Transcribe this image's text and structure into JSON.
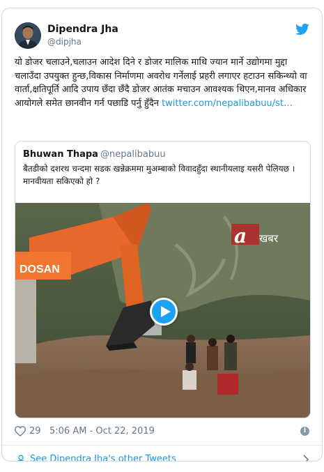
{
  "tweet": {
    "author_name": "Dipendra Jha",
    "author_handle": "@dipjha",
    "text": "यो डोजर चलाउने,चलाउन आदेश दिने र डोजर मालिक माथि ज्यान मार्ने उद्योगमा मुद्दा चलाउँदा उपयुक्त हुन्छ,विकास निर्माणमा अवरोध गर्नेलाई प्रहरी लगाएर हटाउन सकिन्थ्यो वा वार्ता,क्षतिपूर्ति आदि उपाय छँदा छँदै डोजर आतंक मचाउन आवश्यक थिएन,मानव अधिकार आयोगले समेत छानवीन गर्न पछाडि पर्नु हुँदैन",
    "link_text": "twitter.com/nepalibabuu/st…",
    "likes": "29",
    "timestamp": "5:06 AM - Oct 22, 2019"
  },
  "quoted_tweet": {
    "author_name": "Bhuwan Thapa",
    "author_handle": "@nepalibabuu",
    "text": "बैतडीको दशरथ चन्दमा सडक खन्नेक्रममा मुअम्बाको विवादहुँदा स्थानीयलाइ यसरी पेलियछ । मानवीयता सकिएको हो ?"
  },
  "video": {
    "watermark_brand": "a",
    "watermark_text": "खबर",
    "excavator_brand": "DOSAN"
  },
  "footer": {
    "see_more_label": "See Dipendra Jha's other Tweets"
  },
  "colors": {
    "link": "#1b95e0",
    "twitter_blue": "#1da1f2",
    "border": "#cfd9de",
    "secondary_text": "#657786"
  }
}
